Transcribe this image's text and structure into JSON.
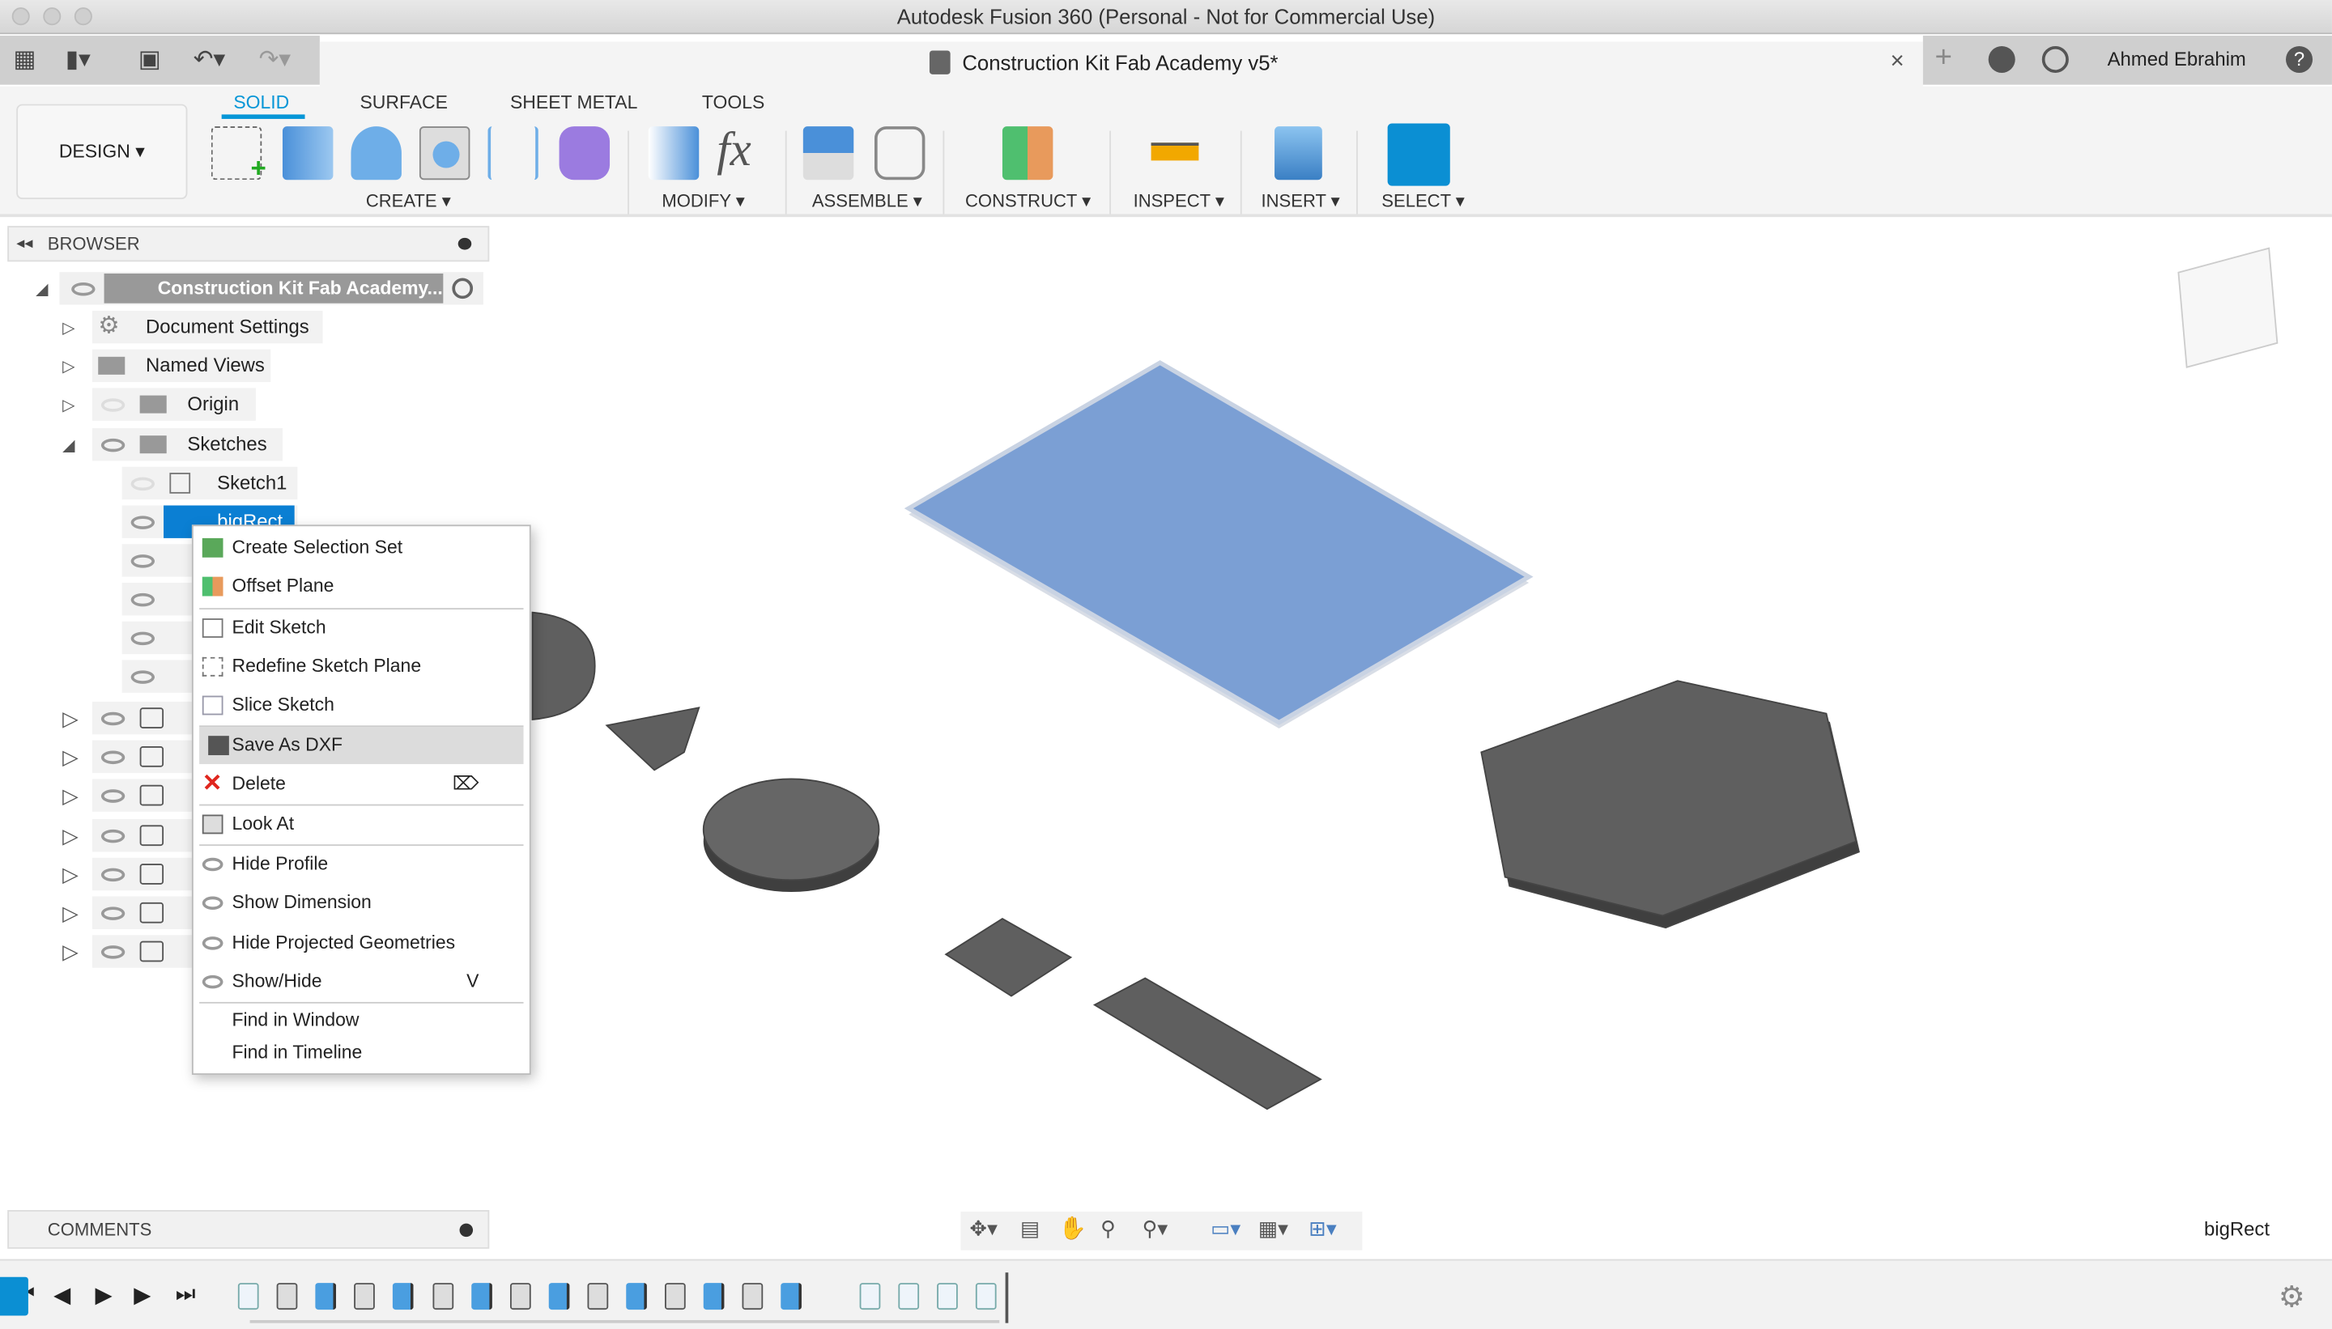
{
  "window": {
    "title": "Autodesk Fusion 360 (Personal - Not for Commercial Use)"
  },
  "document_tab": {
    "title": "Construction Kit Fab Academy v5*",
    "close": "×"
  },
  "user": {
    "name": "Ahmed Ebrahim"
  },
  "workspace": {
    "label": "DESIGN ▾"
  },
  "tabs": [
    {
      "label": "SOLID",
      "active": true
    },
    {
      "label": "SURFACE"
    },
    {
      "label": "SHEET METAL"
    },
    {
      "label": "TOOLS"
    }
  ],
  "groups": {
    "create": "CREATE ▾",
    "modify": "MODIFY ▾",
    "assemble": "ASSEMBLE ▾",
    "construct": "CONSTRUCT ▾",
    "inspect": "INSPECT ▾",
    "insert": "INSERT ▾",
    "select": "SELECT ▾"
  },
  "browser": {
    "title": "BROWSER",
    "root": "Construction Kit Fab Academy...",
    "items": [
      "Document Settings",
      "Named Views",
      "Origin",
      "Sketches"
    ],
    "sketches": [
      "Sketch1",
      "bigRect"
    ]
  },
  "context_menu": {
    "items": [
      {
        "label": "Create Selection Set",
        "icon": "selection-set-icon"
      },
      {
        "label": "Offset Plane",
        "icon": "offset-plane-icon"
      },
      {
        "label": "Edit Sketch",
        "icon": "edit-sketch-icon"
      },
      {
        "label": "Redefine Sketch Plane",
        "icon": "redefine-plane-icon"
      },
      {
        "label": "Slice Sketch",
        "icon": "slice-icon"
      },
      {
        "label": "Save As DXF",
        "icon": "dxf-icon",
        "highlighted": true
      },
      {
        "label": "Delete",
        "icon": "delete-icon",
        "shortcut": "⌦"
      },
      {
        "label": "Look At",
        "icon": "look-at-icon"
      },
      {
        "label": "Hide Profile",
        "icon": "eye-icon"
      },
      {
        "label": "Show Dimension",
        "icon": "eye-icon"
      },
      {
        "label": "Hide Projected Geometries",
        "icon": "eye-icon"
      },
      {
        "label": "Show/Hide",
        "icon": "eye-icon",
        "shortcut": "V"
      },
      {
        "label": "Find in Window"
      },
      {
        "label": "Find in Timeline"
      }
    ]
  },
  "comments": {
    "title": "COMMENTS"
  },
  "status": {
    "selection": "bigRect"
  },
  "timeline": {
    "items": [
      "sketch",
      "body",
      "extrude",
      "body",
      "extrude",
      "body",
      "extrude",
      "body",
      "extrude",
      "body",
      "extrude",
      "body",
      "extrude",
      "body",
      "extrude",
      "sketch-selected",
      "sketch",
      "sketch",
      "sketch",
      "sketch"
    ]
  },
  "colors": {
    "accent": "#0696d7",
    "selected_plate": "#7b9fd4",
    "part": "#5f5f5f"
  }
}
